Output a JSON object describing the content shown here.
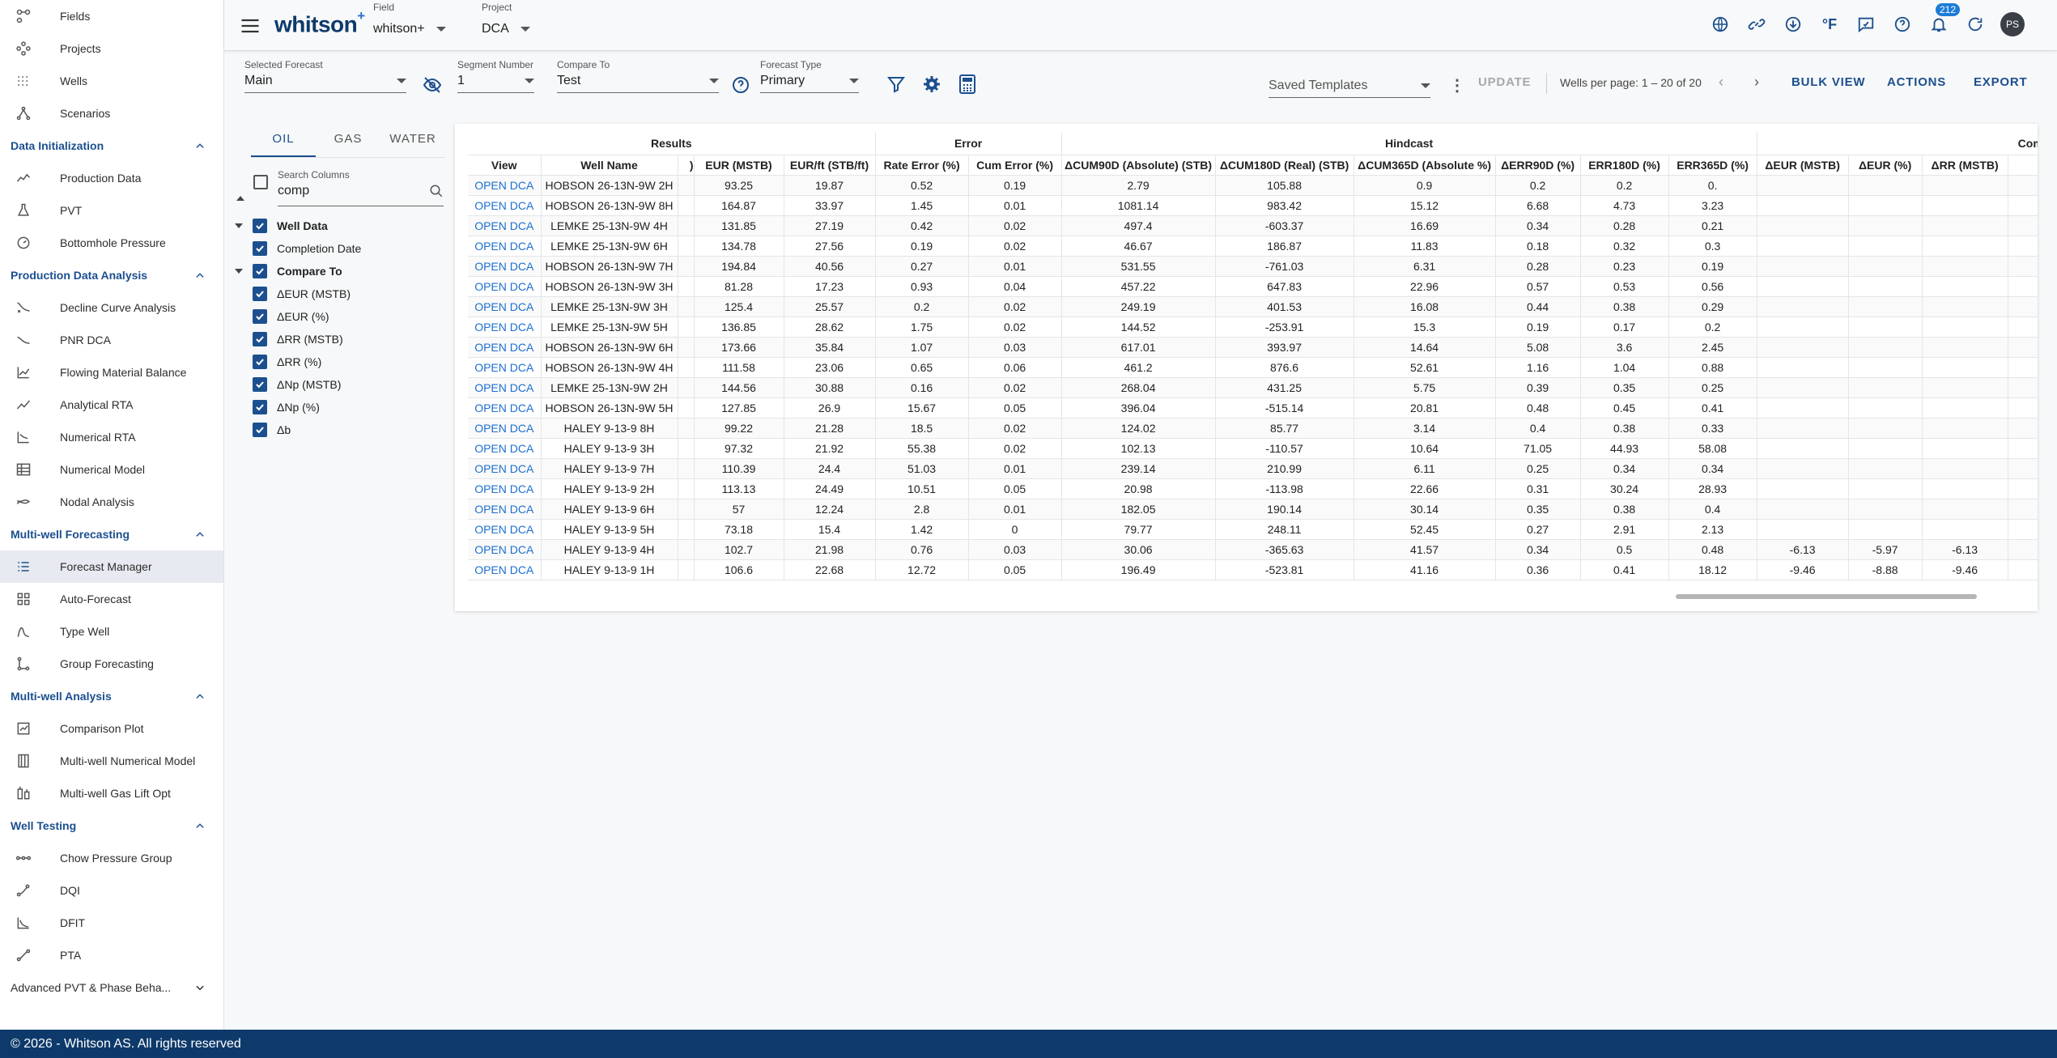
{
  "sidebar": {
    "top_items": [
      {
        "label": "Fields",
        "icon": "fields-icon"
      },
      {
        "label": "Projects",
        "icon": "projects-icon"
      },
      {
        "label": "Wells",
        "icon": "wells-icon"
      },
      {
        "label": "Scenarios",
        "icon": "scenarios-icon"
      }
    ],
    "sections": [
      {
        "title": "Data Initialization",
        "expanded": true,
        "items": [
          {
            "label": "Production Data",
            "icon": "production-data-icon"
          },
          {
            "label": "PVT",
            "icon": "pvt-icon"
          },
          {
            "label": "Bottomhole Pressure",
            "icon": "bottomhole-pressure-icon"
          }
        ]
      },
      {
        "title": "Production Data Analysis",
        "expanded": true,
        "items": [
          {
            "label": "Decline Curve Analysis",
            "icon": "decline-curve-icon"
          },
          {
            "label": "PNR DCA",
            "icon": "pnr-dca-icon"
          },
          {
            "label": "Flowing Material Balance",
            "icon": "flowing-material-balance-icon"
          },
          {
            "label": "Analytical RTA",
            "icon": "analytical-rta-icon"
          },
          {
            "label": "Numerical RTA",
            "icon": "numerical-rta-icon"
          },
          {
            "label": "Numerical Model",
            "icon": "numerical-model-icon"
          },
          {
            "label": "Nodal Analysis",
            "icon": "nodal-analysis-icon"
          }
        ]
      },
      {
        "title": "Multi-well Forecasting",
        "expanded": true,
        "items": [
          {
            "label": "Forecast Manager",
            "icon": "forecast-manager-icon",
            "active": true
          },
          {
            "label": "Auto-Forecast",
            "icon": "auto-forecast-icon"
          },
          {
            "label": "Type Well",
            "icon": "type-well-icon"
          },
          {
            "label": "Group Forecasting",
            "icon": "group-forecasting-icon"
          }
        ]
      },
      {
        "title": "Multi-well Analysis",
        "expanded": true,
        "items": [
          {
            "label": "Comparison Plot",
            "icon": "comparison-plot-icon"
          },
          {
            "label": "Multi-well Numerical Model",
            "icon": "multiwell-numerical-model-icon"
          },
          {
            "label": "Multi-well Gas Lift Opt",
            "icon": "gas-lift-icon"
          }
        ]
      },
      {
        "title": "Well Testing",
        "expanded": true,
        "items": [
          {
            "label": "Chow Pressure Group",
            "icon": "chow-pressure-icon"
          },
          {
            "label": "DQI",
            "icon": "dqi-icon"
          },
          {
            "label": "DFIT",
            "icon": "dfit-icon"
          },
          {
            "label": "PTA",
            "icon": "pta-icon"
          }
        ]
      }
    ],
    "collapsed_section": "Advanced PVT & Phase Beha..."
  },
  "footer": {
    "text": "© 2026 - Whitson AS. All rights reserved"
  },
  "topbar": {
    "logo": "whitson",
    "logo_sup": "+",
    "field_label": "Field",
    "field_value": "whitson+",
    "project_label": "Project",
    "project_value": "DCA",
    "notification_count": "212",
    "avatar_initials": "PS",
    "icons": [
      "globe-icon",
      "link-icon",
      "download-icon",
      "temperature-unit-icon",
      "feedback-icon",
      "help-icon",
      "notifications-icon",
      "refresh-icon"
    ]
  },
  "toolbar": {
    "selected_forecast_label": "Selected Forecast",
    "selected_forecast_value": "Main",
    "segment_label": "Segment Number",
    "segment_value": "1",
    "compare_label": "Compare To",
    "compare_value": "Test",
    "forecast_type_label": "Forecast Type",
    "forecast_type_value": "Primary",
    "saved_templates": "Saved Templates",
    "update": "UPDATE",
    "pagination": "Wells per page: 1 – 20 of 20",
    "bulk_view": "BULK VIEW",
    "actions": "ACTIONS",
    "export": "EXPORT"
  },
  "column_panel": {
    "tabs": [
      "OIL",
      "GAS",
      "WATER"
    ],
    "search_label": "Search Columns",
    "search_value": "comp",
    "groups": [
      {
        "label": "Well Data",
        "children": [
          "Completion Date"
        ]
      },
      {
        "label": "Compare To",
        "children": [
          "ΔEUR (MSTB)",
          "ΔEUR (%)",
          "ΔRR (MSTB)",
          "ΔRR (%)",
          "ΔNp (MSTB)",
          "ΔNp (%)",
          "Δb"
        ]
      }
    ]
  },
  "table": {
    "groups": [
      {
        "label": "Results"
      },
      {
        "label": "Error"
      },
      {
        "label": "Hindcast"
      },
      {
        "label": "Compa"
      }
    ],
    "columns": [
      "View",
      "Well Name",
      ")",
      "EUR (MSTB)",
      "EUR/ft (STB/ft)",
      "Rate Error (%)",
      "Cum Error (%)",
      "ΔCUM90D (Absolute) (STB)",
      "ΔCUM180D (Real) (STB)",
      "ΔCUM365D (Absolute %)",
      "ΔERR90D (%)",
      "ERR180D (%)",
      "ERR365D (%)",
      "ΔEUR (MSTB)",
      "ΔEUR (%)",
      "ΔRR (MSTB)",
      ""
    ],
    "rows": [
      [
        "OPEN DCA",
        "HOBSON 26-13N-9W 2H",
        "",
        "93.25",
        "19.87",
        "0.52",
        "0.19",
        "2.79",
        "105.88",
        "0.9",
        "0.2",
        "0.2",
        "0.",
        "",
        "",
        "",
        ""
      ],
      [
        "OPEN DCA",
        "HOBSON 26-13N-9W 8H",
        "",
        "164.87",
        "33.97",
        "1.45",
        "0.01",
        "1081.14",
        "983.42",
        "15.12",
        "6.68",
        "4.73",
        "3.23",
        "",
        "",
        "",
        ""
      ],
      [
        "OPEN DCA",
        "LEMKE 25-13N-9W 4H",
        "",
        "131.85",
        "27.19",
        "0.42",
        "0.02",
        "497.4",
        "-603.37",
        "16.69",
        "0.34",
        "0.28",
        "0.21",
        "",
        "",
        "",
        ""
      ],
      [
        "OPEN DCA",
        "LEMKE 25-13N-9W 6H",
        "",
        "134.78",
        "27.56",
        "0.19",
        "0.02",
        "46.67",
        "186.87",
        "11.83",
        "0.18",
        "0.32",
        "0.3",
        "",
        "",
        "",
        ""
      ],
      [
        "OPEN DCA",
        "HOBSON 26-13N-9W 7H",
        "",
        "194.84",
        "40.56",
        "0.27",
        "0.01",
        "531.55",
        "-761.03",
        "6.31",
        "0.28",
        "0.23",
        "0.19",
        "",
        "",
        "",
        ""
      ],
      [
        "OPEN DCA",
        "HOBSON 26-13N-9W 3H",
        "",
        "81.28",
        "17.23",
        "0.93",
        "0.04",
        "457.22",
        "647.83",
        "22.96",
        "0.57",
        "0.53",
        "0.56",
        "",
        "",
        "",
        ""
      ],
      [
        "OPEN DCA",
        "LEMKE 25-13N-9W 3H",
        "",
        "125.4",
        "25.57",
        "0.2",
        "0.02",
        "249.19",
        "401.53",
        "16.08",
        "0.44",
        "0.38",
        "0.29",
        "",
        "",
        "",
        ""
      ],
      [
        "OPEN DCA",
        "LEMKE 25-13N-9W 5H",
        "",
        "136.85",
        "28.62",
        "1.75",
        "0.02",
        "144.52",
        "-253.91",
        "15.3",
        "0.19",
        "0.17",
        "0.2",
        "",
        "",
        "",
        ""
      ],
      [
        "OPEN DCA",
        "HOBSON 26-13N-9W 6H",
        "",
        "173.66",
        "35.84",
        "1.07",
        "0.03",
        "617.01",
        "393.97",
        "14.64",
        "5.08",
        "3.6",
        "2.45",
        "",
        "",
        "",
        ""
      ],
      [
        "OPEN DCA",
        "HOBSON 26-13N-9W 4H",
        "",
        "111.58",
        "23.06",
        "0.65",
        "0.06",
        "461.2",
        "876.6",
        "52.61",
        "1.16",
        "1.04",
        "0.88",
        "",
        "",
        "",
        ""
      ],
      [
        "OPEN DCA",
        "LEMKE 25-13N-9W 2H",
        "",
        "144.56",
        "30.88",
        "0.16",
        "0.02",
        "268.04",
        "431.25",
        "5.75",
        "0.39",
        "0.35",
        "0.25",
        "",
        "",
        "",
        ""
      ],
      [
        "OPEN DCA",
        "HOBSON 26-13N-9W 5H",
        "",
        "127.85",
        "26.9",
        "15.67",
        "0.05",
        "396.04",
        "-515.14",
        "20.81",
        "0.48",
        "0.45",
        "0.41",
        "",
        "",
        "",
        ""
      ],
      [
        "OPEN DCA",
        "HALEY 9-13-9 8H",
        "",
        "99.22",
        "21.28",
        "18.5",
        "0.02",
        "124.02",
        "85.77",
        "3.14",
        "0.4",
        "0.38",
        "0.33",
        "",
        "",
        "",
        ""
      ],
      [
        "OPEN DCA",
        "HALEY 9-13-9 3H",
        "",
        "97.32",
        "21.92",
        "55.38",
        "0.02",
        "102.13",
        "-110.57",
        "10.64",
        "71.05",
        "44.93",
        "58.08",
        "",
        "",
        "",
        ""
      ],
      [
        "OPEN DCA",
        "HALEY 9-13-9 7H",
        "",
        "110.39",
        "24.4",
        "51.03",
        "0.01",
        "239.14",
        "210.99",
        "6.11",
        "0.25",
        "0.34",
        "0.34",
        "",
        "",
        "",
        ""
      ],
      [
        "OPEN DCA",
        "HALEY 9-13-9 2H",
        "",
        "113.13",
        "24.49",
        "10.51",
        "0.05",
        "20.98",
        "-113.98",
        "22.66",
        "0.31",
        "30.24",
        "28.93",
        "",
        "",
        "",
        ""
      ],
      [
        "OPEN DCA",
        "HALEY 9-13-9 6H",
        "",
        "57",
        "12.24",
        "2.8",
        "0.01",
        "182.05",
        "190.14",
        "30.14",
        "0.35",
        "0.38",
        "0.4",
        "",
        "",
        "",
        ""
      ],
      [
        "OPEN DCA",
        "HALEY 9-13-9 5H",
        "",
        "73.18",
        "15.4",
        "1.42",
        "0",
        "79.77",
        "248.11",
        "52.45",
        "0.27",
        "2.91",
        "2.13",
        "",
        "",
        "",
        ""
      ],
      [
        "OPEN DCA",
        "HALEY 9-13-9 4H",
        "",
        "102.7",
        "21.98",
        "0.76",
        "0.03",
        "30.06",
        "-365.63",
        "41.57",
        "0.34",
        "0.5",
        "0.48",
        "-6.13",
        "-5.97",
        "-6.13",
        ""
      ],
      [
        "OPEN DCA",
        "HALEY 9-13-9 1H",
        "",
        "106.6",
        "22.68",
        "12.72",
        "0.05",
        "196.49",
        "-523.81",
        "41.16",
        "0.36",
        "0.41",
        "18.12",
        "-9.46",
        "-8.88",
        "-9.46",
        ""
      ]
    ]
  }
}
